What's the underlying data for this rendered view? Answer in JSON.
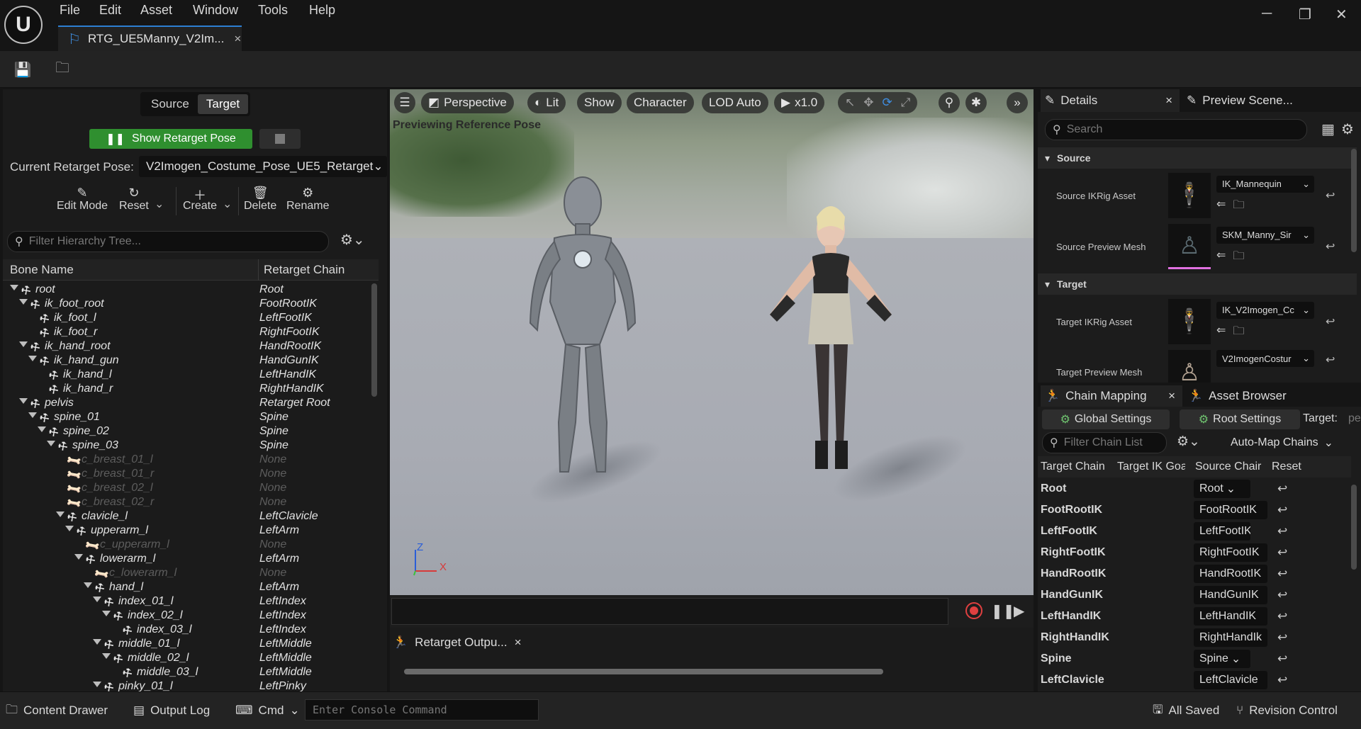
{
  "menu": [
    "File",
    "Edit",
    "Asset",
    "Window",
    "Tools",
    "Help"
  ],
  "logo": "U",
  "document_tab": {
    "title": "RTG_UE5Manny_V2Im...",
    "close": "×"
  },
  "window_controls": {
    "minimize": "─",
    "maximize": "❐",
    "close": "✕"
  },
  "left_panel": {
    "mode_toggle": {
      "source": "Source",
      "target": "Target",
      "active": "Target"
    },
    "show_retarget_pose": "Show Retarget Pose",
    "current_pose_label": "Current Retarget Pose:",
    "current_pose_value": "V2Imogen_Costume_Pose_UE5_Retarget",
    "tools": [
      {
        "label": "Edit Mode",
        "icon": "pencil-icon"
      },
      {
        "label": "Reset",
        "icon": "refresh-icon"
      },
      {
        "label": "Create",
        "icon": "plus-icon"
      },
      {
        "label": "Delete",
        "icon": "trash-icon"
      },
      {
        "label": "Rename",
        "icon": "gear-icon"
      }
    ],
    "filter_placeholder": "Filter Hierarchy Tree...",
    "columns": {
      "bone": "Bone Name",
      "chain": "Retarget Chain"
    },
    "bones": [
      {
        "name": "root",
        "chain": "Root",
        "depth": 0,
        "expandable": true,
        "dim": false
      },
      {
        "name": "ik_foot_root",
        "chain": "FootRootIK",
        "depth": 1,
        "expandable": true,
        "dim": false
      },
      {
        "name": "ik_foot_l",
        "chain": "LeftFootIK",
        "depth": 2,
        "expandable": false,
        "dim": false
      },
      {
        "name": "ik_foot_r",
        "chain": "RightFootIK",
        "depth": 2,
        "expandable": false,
        "dim": false
      },
      {
        "name": "ik_hand_root",
        "chain": "HandRootIK",
        "depth": 1,
        "expandable": true,
        "dim": false
      },
      {
        "name": "ik_hand_gun",
        "chain": "HandGunIK",
        "depth": 2,
        "expandable": true,
        "dim": false
      },
      {
        "name": "ik_hand_l",
        "chain": "LeftHandIK",
        "depth": 3,
        "expandable": false,
        "dim": false
      },
      {
        "name": "ik_hand_r",
        "chain": "RightHandIK",
        "depth": 3,
        "expandable": false,
        "dim": false
      },
      {
        "name": "pelvis",
        "chain": "Retarget Root",
        "depth": 1,
        "expandable": true,
        "dim": false
      },
      {
        "name": "spine_01",
        "chain": "Spine",
        "depth": 2,
        "expandable": true,
        "dim": false
      },
      {
        "name": "spine_02",
        "chain": "Spine",
        "depth": 3,
        "expandable": true,
        "dim": false
      },
      {
        "name": "spine_03",
        "chain": "Spine",
        "depth": 4,
        "expandable": true,
        "dim": false
      },
      {
        "name": "c_breast_01_l",
        "chain": "None",
        "depth": 5,
        "expandable": false,
        "dim": true
      },
      {
        "name": "c_breast_01_r",
        "chain": "None",
        "depth": 5,
        "expandable": false,
        "dim": true
      },
      {
        "name": "c_breast_02_l",
        "chain": "None",
        "depth": 5,
        "expandable": false,
        "dim": true
      },
      {
        "name": "c_breast_02_r",
        "chain": "None",
        "depth": 5,
        "expandable": false,
        "dim": true
      },
      {
        "name": "clavicle_l",
        "chain": "LeftClavicle",
        "depth": 5,
        "expandable": true,
        "dim": false
      },
      {
        "name": "upperarm_l",
        "chain": "LeftArm",
        "depth": 6,
        "expandable": true,
        "dim": false
      },
      {
        "name": "c_upperarm_l",
        "chain": "None",
        "depth": 7,
        "expandable": false,
        "dim": true
      },
      {
        "name": "lowerarm_l",
        "chain": "LeftArm",
        "depth": 7,
        "expandable": true,
        "dim": false
      },
      {
        "name": "c_lowerarm_l",
        "chain": "None",
        "depth": 8,
        "expandable": false,
        "dim": true
      },
      {
        "name": "hand_l",
        "chain": "LeftArm",
        "depth": 8,
        "expandable": true,
        "dim": false
      },
      {
        "name": "index_01_l",
        "chain": "LeftIndex",
        "depth": 9,
        "expandable": true,
        "dim": false
      },
      {
        "name": "index_02_l",
        "chain": "LeftIndex",
        "depth": 10,
        "expandable": true,
        "dim": false
      },
      {
        "name": "index_03_l",
        "chain": "LeftIndex",
        "depth": 11,
        "expandable": false,
        "dim": false
      },
      {
        "name": "middle_01_l",
        "chain": "LeftMiddle",
        "depth": 9,
        "expandable": true,
        "dim": false
      },
      {
        "name": "middle_02_l",
        "chain": "LeftMiddle",
        "depth": 10,
        "expandable": true,
        "dim": false
      },
      {
        "name": "middle_03_l",
        "chain": "LeftMiddle",
        "depth": 11,
        "expandable": false,
        "dim": false
      },
      {
        "name": "pinky_01_l",
        "chain": "LeftPinky",
        "depth": 9,
        "expandable": true,
        "dim": false
      }
    ]
  },
  "viewport": {
    "perspective": "Perspective",
    "lit": "Lit",
    "show": "Show",
    "character": "Character",
    "lod": "LOD Auto",
    "speed": "x1.0",
    "status": "Previewing Reference Pose",
    "axis": {
      "z": "Z",
      "x": "X"
    }
  },
  "output_tab": {
    "label": "Retarget Outpu...",
    "close": "×"
  },
  "details": {
    "tab_details": "Details",
    "tab_close": "×",
    "tab_preview": "Preview Scene...",
    "search_placeholder": "Search",
    "source_header": "Source",
    "target_header": "Target",
    "props": [
      {
        "label": "Source IKRig Asset",
        "value": "IK_Mannequin",
        "thumb": "ikrig-icon"
      },
      {
        "label": "Source Preview Mesh",
        "value": "SKM_Manny_Sir",
        "thumb": "mesh-icon"
      },
      {
        "label": "Target IKRig Asset",
        "value": "IK_V2Imogen_Cc",
        "thumb": "ikrig-icon"
      },
      {
        "label": "Target Preview Mesh",
        "value": "V2ImogenCostur",
        "thumb": "mesh-icon"
      }
    ]
  },
  "chain_mapping": {
    "tab": "Chain Mapping",
    "tab_close": "×",
    "tab_assets": "Asset Browser",
    "global_settings": "Global Settings",
    "root_settings": "Root Settings",
    "target_label": "Target:",
    "target_value": "pe",
    "filter_placeholder": "Filter Chain List",
    "auto_map": "Auto-Map Chains",
    "columns": {
      "target_chain": "Target Chain",
      "target_ik": "Target IK Goa",
      "source_chain": "Source Chair",
      "reset": "Reset"
    },
    "rows": [
      {
        "target": "Root",
        "source": "Root",
        "dropdown": true
      },
      {
        "target": "FootRootIK",
        "source": "FootRootIK",
        "dropdown": false
      },
      {
        "target": "LeftFootIK",
        "source": "LeftFootIK",
        "dropdown": true
      },
      {
        "target": "RightFootIK",
        "source": "RightFootIK",
        "dropdown": false
      },
      {
        "target": "HandRootIK",
        "source": "HandRootIK",
        "dropdown": false
      },
      {
        "target": "HandGunIK",
        "source": "HandGunIK",
        "dropdown": false
      },
      {
        "target": "LeftHandIK",
        "source": "LeftHandIK",
        "dropdown": false
      },
      {
        "target": "RightHandIK",
        "source": "RightHandIk",
        "dropdown": false
      },
      {
        "target": "Spine",
        "source": "Spine",
        "dropdown": true
      },
      {
        "target": "LeftClavicle",
        "source": "LeftClavicle",
        "dropdown": false
      }
    ]
  },
  "statusbar": {
    "content_drawer": "Content Drawer",
    "output_log": "Output Log",
    "cmd": "Cmd",
    "console_placeholder": "Enter Console Command",
    "all_saved": "All Saved",
    "revision_control": "Revision Control"
  },
  "colors": {
    "accent": "#2d7fd3",
    "green_button": "#2f8f2f",
    "record": "#e04040"
  }
}
